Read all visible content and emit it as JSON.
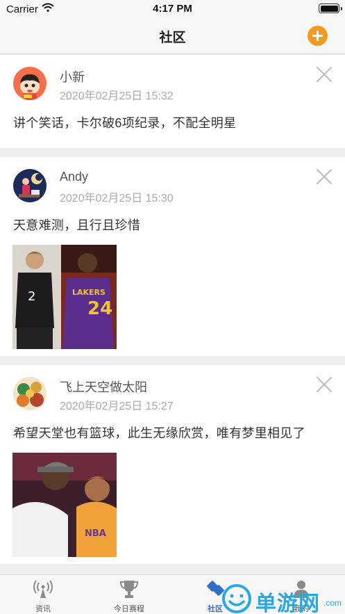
{
  "status_bar": {
    "carrier": "Carrier",
    "time": "4:17 PM"
  },
  "nav": {
    "title": "社区"
  },
  "posts": [
    {
      "name": "小新",
      "time": "2020年02月25日 15:32",
      "text": "讲个笑话，卡尔破6项纪录，不配全明星"
    },
    {
      "name": "Andy",
      "time": "2020年02月25日 15:30",
      "text": "天意难测，且行且珍惜"
    },
    {
      "name": "飞上天空做太阳",
      "time": "2020年02月25日 15:27",
      "text": "希望天堂也有篮球，此生无缘欣赏，唯有梦里相见了"
    }
  ],
  "tabs": [
    {
      "label": "资讯",
      "icon": "broadcast-icon"
    },
    {
      "label": "今日赛程",
      "icon": "trophy-icon"
    },
    {
      "label": "社区",
      "icon": "community-icon"
    },
    {
      "label": "我的",
      "icon": "profile-icon"
    }
  ],
  "watermark": {
    "text": "单游网",
    "domain": ".com"
  },
  "colors": {
    "accent": "#f39b1c",
    "active_tab": "#2f6fc9",
    "watermark": "#28a7e3"
  }
}
